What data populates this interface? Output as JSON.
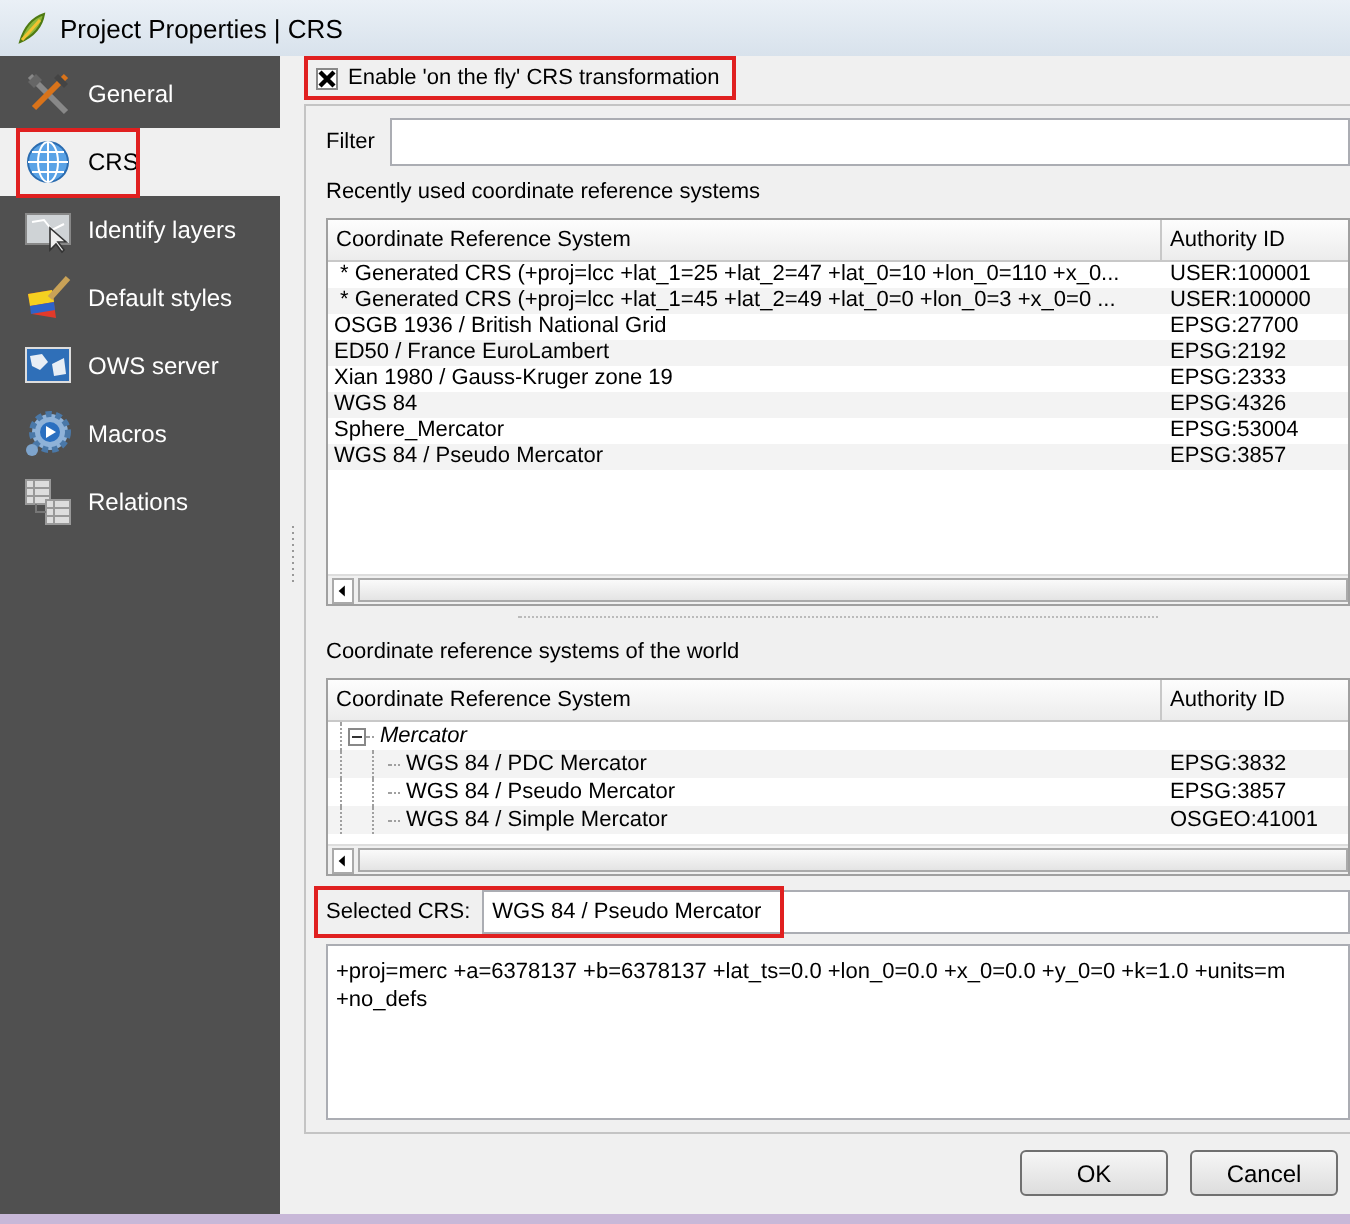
{
  "window": {
    "title": "Project Properties | CRS"
  },
  "sidebar": {
    "items": [
      {
        "label": "General",
        "selected": false,
        "highlighted": false
      },
      {
        "label": "CRS",
        "selected": true,
        "highlighted": true
      },
      {
        "label": "Identify layers",
        "selected": false,
        "highlighted": false
      },
      {
        "label": "Default styles",
        "selected": false,
        "highlighted": false
      },
      {
        "label": "OWS server",
        "selected": false,
        "highlighted": false
      },
      {
        "label": "Macros",
        "selected": false,
        "highlighted": false
      },
      {
        "label": "Relations",
        "selected": false,
        "highlighted": false
      }
    ]
  },
  "otf_transform": {
    "label": "Enable 'on the fly' CRS transformation",
    "checked": true,
    "highlighted": true
  },
  "filter": {
    "label": "Filter"
  },
  "recent": {
    "title": "Recently used coordinate reference systems",
    "columns": [
      "Coordinate Reference System",
      "Authority ID"
    ],
    "rows": [
      {
        "name": " * Generated CRS (+proj=lcc +lat_1=25 +lat_2=47 +lat_0=10 +lon_0=110 +x_0...",
        "authority_id": "USER:100001"
      },
      {
        "name": " * Generated CRS (+proj=lcc +lat_1=45 +lat_2=49 +lat_0=0 +lon_0=3 +x_0=0 ...",
        "authority_id": "USER:100000"
      },
      {
        "name": "OSGB 1936 / British National Grid",
        "authority_id": "EPSG:27700"
      },
      {
        "name": "ED50 / France EuroLambert",
        "authority_id": "EPSG:2192"
      },
      {
        "name": "Xian 1980 / Gauss-Kruger zone 19",
        "authority_id": "EPSG:2333"
      },
      {
        "name": "WGS 84",
        "authority_id": "EPSG:4326"
      },
      {
        "name": "Sphere_Mercator",
        "authority_id": "EPSG:53004"
      },
      {
        "name": "WGS 84 / Pseudo Mercator",
        "authority_id": "EPSG:3857"
      }
    ]
  },
  "world": {
    "title": "Coordinate reference systems of the world",
    "columns": [
      "Coordinate Reference System",
      "Authority ID"
    ],
    "rows": [
      {
        "name": "Mercator",
        "expanded": true,
        "children": [
          {
            "name": "WGS 84 / PDC Mercator",
            "authority_id": "EPSG:3832"
          },
          {
            "name": "WGS 84 / Pseudo Mercator",
            "authority_id": "EPSG:3857"
          },
          {
            "name": "WGS 84 / Simple Mercator",
            "authority_id": "OSGEO:41001"
          }
        ]
      }
    ]
  },
  "selected_crs": {
    "label": "Selected CRS:",
    "value": "WGS 84 / Pseudo Mercator",
    "highlighted": true
  },
  "proj_string": "+proj=merc +a=6378137 +b=6378137 +lat_ts=0.0 +lon_0=0.0 +x_0=0.0 +y_0=0 +k=1.0 +units=m +no_defs",
  "buttons": [
    "OK",
    "Cancel"
  ]
}
